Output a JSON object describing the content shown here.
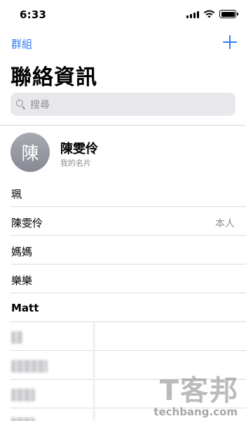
{
  "status_bar": {
    "time": "6:33"
  },
  "nav": {
    "groups_label": "群組"
  },
  "page_title": "聯絡資訊",
  "search": {
    "placeholder": "搜尋"
  },
  "my_card": {
    "avatar_initial": "陳",
    "name": "陳雯伶",
    "subtitle": "我的名片"
  },
  "contacts": [
    {
      "name": "珮",
      "tag": ""
    },
    {
      "name": "陳雯伶",
      "tag": "本人"
    },
    {
      "name": "媽媽",
      "tag": ""
    },
    {
      "name": "樂樂",
      "tag": ""
    },
    {
      "name": "Matt",
      "tag": ""
    }
  ],
  "watermark": {
    "chars": "T客邦",
    "text": "techbang.com"
  },
  "colors": {
    "accent": "#2f7cf6",
    "secondary_text": "#8e8e93",
    "search_bg": "#e7e7ec"
  }
}
